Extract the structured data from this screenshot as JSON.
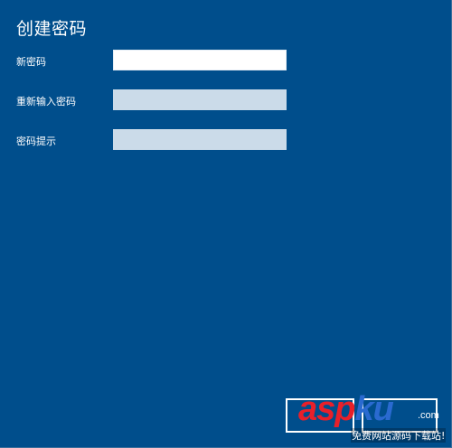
{
  "dialog": {
    "title": "创建密码",
    "fields": [
      {
        "label": "新密码",
        "value": "",
        "placeholder": ""
      },
      {
        "label": "重新输入密码",
        "value": "",
        "placeholder": ""
      },
      {
        "label": "密码提示",
        "value": "",
        "placeholder": ""
      }
    ]
  },
  "watermark": {
    "logo": "aspku",
    "tld": ".com",
    "tagline": "免费网站源码下载站!"
  },
  "colors": {
    "background": "#004e8c",
    "active_field": "#ffffff",
    "inactive_field": "#cbdbe9",
    "text": "#ffffff",
    "logo_red": "#e8202a",
    "logo_blue": "#2a6ad0"
  }
}
